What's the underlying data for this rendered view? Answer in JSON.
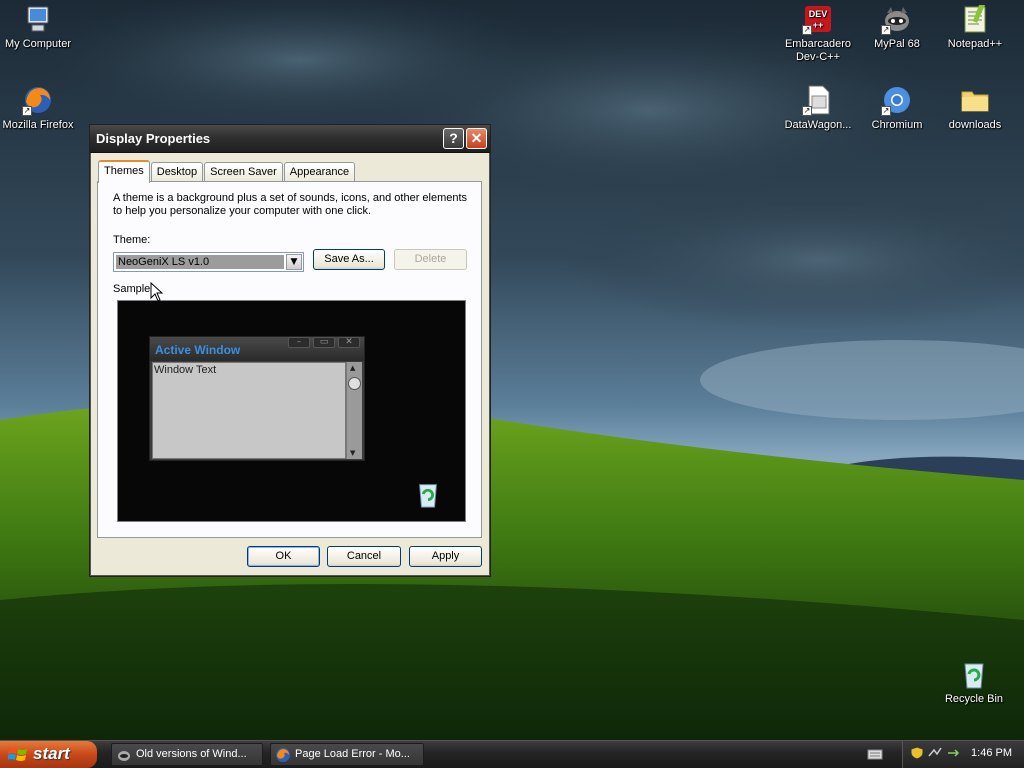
{
  "desktop": {
    "icons": [
      {
        "label": "My Computer",
        "icon": "my-computer-icon"
      },
      {
        "label": "Mozilla Firefox",
        "icon": "firefox-icon"
      },
      {
        "label": "Embarcadero Dev-C++",
        "icon": "devcpp-icon",
        "badge": "DEV ++"
      },
      {
        "label": "MyPal 68",
        "icon": "mypal-icon"
      },
      {
        "label": "Notepad++",
        "icon": "notepadpp-icon"
      },
      {
        "label": "DataWagon...",
        "icon": "datawagon-icon"
      },
      {
        "label": "Chromium",
        "icon": "chromium-icon"
      },
      {
        "label": "downloads",
        "icon": "folder-icon"
      },
      {
        "label": "Recycle Bin",
        "icon": "recycle-bin-icon"
      }
    ]
  },
  "dialog": {
    "title": "Display Properties",
    "help_glyph": "?",
    "close_glyph": "✕",
    "tabs": [
      {
        "label": "Themes",
        "active": true
      },
      {
        "label": "Desktop",
        "active": false
      },
      {
        "label": "Screen Saver",
        "active": false
      },
      {
        "label": "Appearance",
        "active": false
      }
    ],
    "description": "A theme is a background plus a set of sounds, icons, and other elements to help you personalize your computer with one click.",
    "theme_label": "Theme:",
    "theme_value": "NeoGeniX LS v1.0",
    "save_as_label": "Save As...",
    "delete_label": "Delete",
    "sample_label": "Sample:",
    "sample": {
      "window_title": "Active Window",
      "window_text": "Window Text"
    },
    "ok_label": "OK",
    "cancel_label": "Cancel",
    "apply_label": "Apply"
  },
  "taskbar": {
    "start_label": "start",
    "tasks": [
      {
        "label": "Old versions of Wind...",
        "icon": "mypal-icon"
      },
      {
        "label": "Page Load Error - Mo...",
        "icon": "firefox-icon"
      }
    ],
    "clock": "1:46 PM"
  },
  "colors": {
    "dialog_bg": "#ece9d8",
    "title_bar": "#2e2e2e",
    "start_button": "#c7491a",
    "sample_title": "#3c8fe0"
  }
}
